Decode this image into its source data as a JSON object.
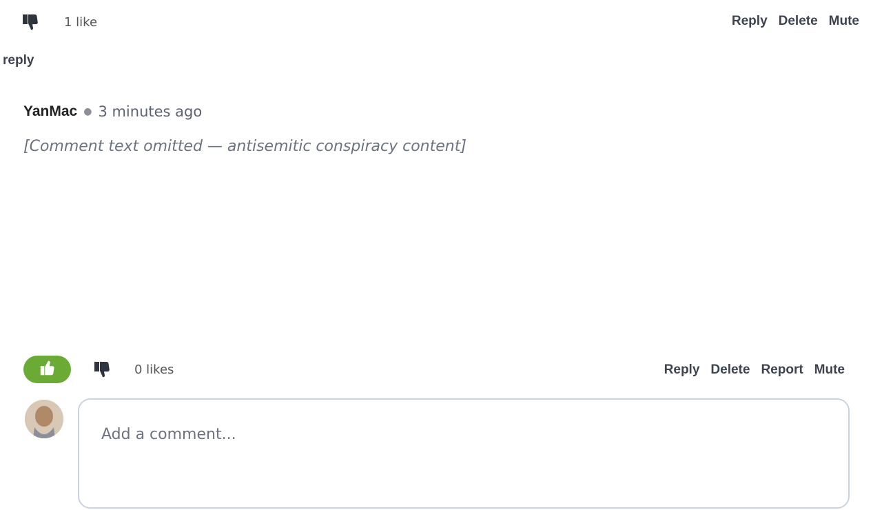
{
  "top": {
    "likes_label": "1 like",
    "actions": {
      "reply": "Reply",
      "delete": "Delete",
      "mute": "Mute"
    },
    "reply_link": "reply"
  },
  "comment": {
    "author": "YanMac",
    "timestamp": "3 minutes ago",
    "body": "[Comment text omitted — antisemitic conspiracy content]",
    "likes_label": "0 likes",
    "actions": {
      "reply": "Reply",
      "delete": "Delete",
      "report": "Report",
      "mute": "Mute"
    }
  },
  "composer": {
    "placeholder": "Add a comment..."
  },
  "colors": {
    "like_green": "#6aaa35",
    "action_text": "#3d4450",
    "box_border": "#c9d3e0"
  },
  "icons": {
    "dislike": "thumbs-down-icon",
    "like": "thumbs-up-icon"
  }
}
